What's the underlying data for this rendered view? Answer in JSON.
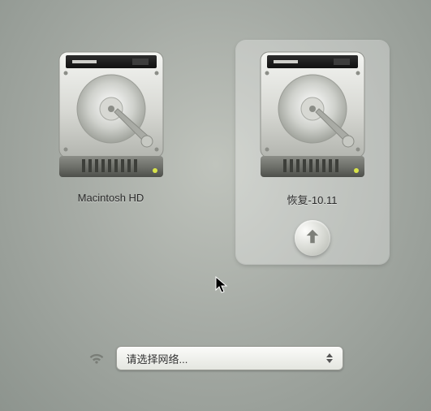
{
  "volumes": [
    {
      "id": "macintosh-hd",
      "label": "Macintosh HD",
      "selected": false
    },
    {
      "id": "recovery",
      "label": "恢复-10.11",
      "selected": true
    }
  ],
  "network": {
    "placeholder": "请选择网络...",
    "selected": ""
  }
}
